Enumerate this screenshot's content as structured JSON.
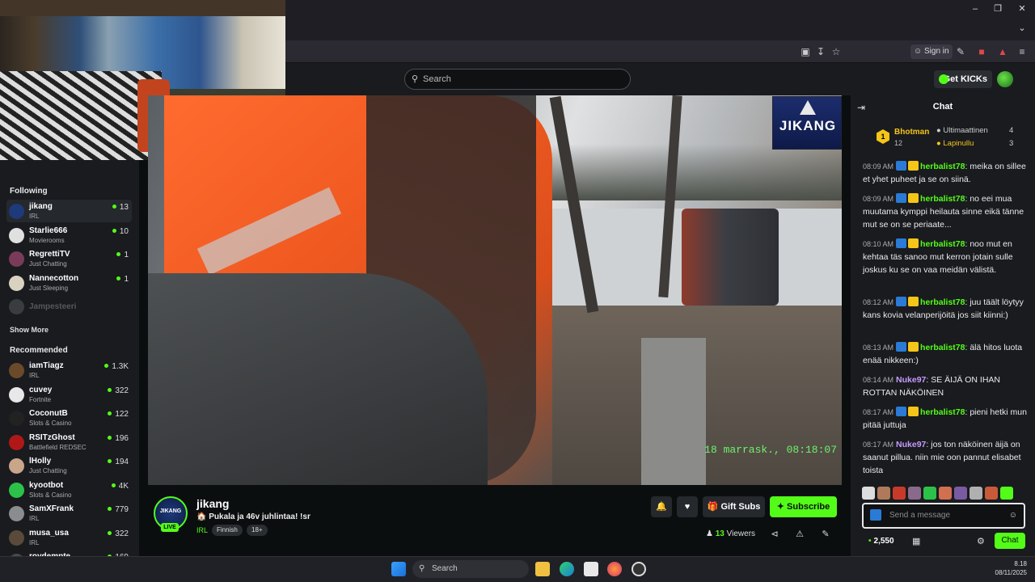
{
  "browser": {
    "signin_label": "Sign in",
    "window_controls": [
      "minimize-icon",
      "restore-icon",
      "close-icon"
    ]
  },
  "header": {
    "search_placeholder": "Search",
    "get_kicks_label": "Get KICKs"
  },
  "sidebar": {
    "following_heading": "Following",
    "following": [
      {
        "name": "jikang",
        "category": "IRL",
        "viewers": "13",
        "active": true,
        "color": "#1e3a7a"
      },
      {
        "name": "Starlie666",
        "category": "Movierooms",
        "viewers": "10",
        "color": "#e0e0e0"
      },
      {
        "name": "RegrettiTV",
        "category": "Just Chatting",
        "viewers": "1",
        "color": "#7a3b5a"
      },
      {
        "name": "Nannecotton",
        "category": "Just Sleeping",
        "viewers": "1",
        "color": "#d9d2c0"
      },
      {
        "name": "Jampesteeri",
        "category": "",
        "viewers": "",
        "offline": true,
        "color": "#3a3d40"
      }
    ],
    "show_more_label": "Show More",
    "recommended_heading": "Recommended",
    "recommended": [
      {
        "name": "iamTiagz",
        "category": "IRL",
        "viewers": "1.3K",
        "color": "#6b4a2a"
      },
      {
        "name": "cuvey",
        "category": "Fortnite",
        "viewers": "322",
        "color": "#e8e8e8"
      },
      {
        "name": "CoconutB",
        "category": "Slots & Casino",
        "viewers": "122",
        "color": "#222"
      },
      {
        "name": "RSITzGhost",
        "category": "Battlefield REDSEC",
        "viewers": "196",
        "color": "#b01818"
      },
      {
        "name": "lHolly",
        "category": "Just Chatting",
        "viewers": "194",
        "color": "#c9a58a"
      },
      {
        "name": "kyootbot",
        "category": "Slots & Casino",
        "viewers": "4K",
        "color": "#2cc24a"
      },
      {
        "name": "SamXFrank",
        "category": "IRL",
        "viewers": "779",
        "color": "#8a8d90"
      },
      {
        "name": "musa_usa",
        "category": "IRL",
        "viewers": "322",
        "color": "#5a4a3a"
      },
      {
        "name": "roydempte",
        "category": "",
        "viewers": "169",
        "color": "#4a4a4a"
      }
    ]
  },
  "video": {
    "timestamp": "18 marrask., 08:18:07",
    "logo_text": "JIKANG"
  },
  "stream": {
    "avatar_text": "JIKANG",
    "live_label": "LIVE",
    "name": "jikang",
    "title": "🏠 Pukala ja 46v juhlintaa! !sr",
    "category": "IRL",
    "tags": [
      "Finnish",
      "18+"
    ],
    "gift_subs_label": "Gift Subs",
    "subscribe_label": "Subscribe",
    "viewers_count": "13",
    "viewers_label": "Viewers"
  },
  "chat": {
    "title": "Chat",
    "leaderboard": {
      "first": {
        "name": "Bhotman",
        "count": "12"
      },
      "second": {
        "name": "Ultimaattinen",
        "count": "4"
      },
      "third": {
        "name": "Lapinullu",
        "count": "3"
      }
    },
    "messages": [
      {
        "time": "08:09 AM",
        "user": "herbalist78",
        "user_color": "#53fc18",
        "badges": true,
        "text": "meika on sillee et yhet puheet ja se on siinä."
      },
      {
        "time": "08:09 AM",
        "user": "herbalist78",
        "user_color": "#53fc18",
        "badges": true,
        "text": "no eei mua muutama kymppi heilauta sinne eikä tänne mut se on se periaate..."
      },
      {
        "time": "08:10 AM",
        "user": "herbalist78",
        "user_color": "#53fc18",
        "badges": true,
        "text": "noo mut en kehtaa täs sanoo mut kerron jotain sulle joskus ku se on vaa meidän välistä."
      },
      {
        "time": "08:12 AM",
        "user": "herbalist78",
        "user_color": "#53fc18",
        "badges": true,
        "text": "juu täält löytyy kans kovia velanperijöitä jos siit kiinni:)"
      },
      {
        "time": "08:13 AM",
        "user": "herbalist78",
        "user_color": "#53fc18",
        "badges": true,
        "text": "älä hitos luota enää nikkeen:)"
      },
      {
        "time": "08:14 AM",
        "user": "Nuke97",
        "user_color": "#c79bff",
        "badges": false,
        "text": "SE ÄIJÄ ON IHAN ROTTAN NÄKÖINEN"
      },
      {
        "time": "08:17 AM",
        "user": "herbalist78",
        "user_color": "#53fc18",
        "badges": true,
        "text": "pieni hetki mun pitää juttuja"
      },
      {
        "time": "08:17 AM",
        "user": "Nuke97",
        "user_color": "#c79bff",
        "badges": false,
        "text": "jos ton näköinen äijä on saanut pillua. niin mie oon pannut elisabet toista"
      }
    ],
    "input_placeholder": "Send a message",
    "points": "2,550",
    "send_label": "Chat"
  },
  "taskbar": {
    "search_label": "Search",
    "time": "8.18",
    "date": "08/11/2025"
  }
}
